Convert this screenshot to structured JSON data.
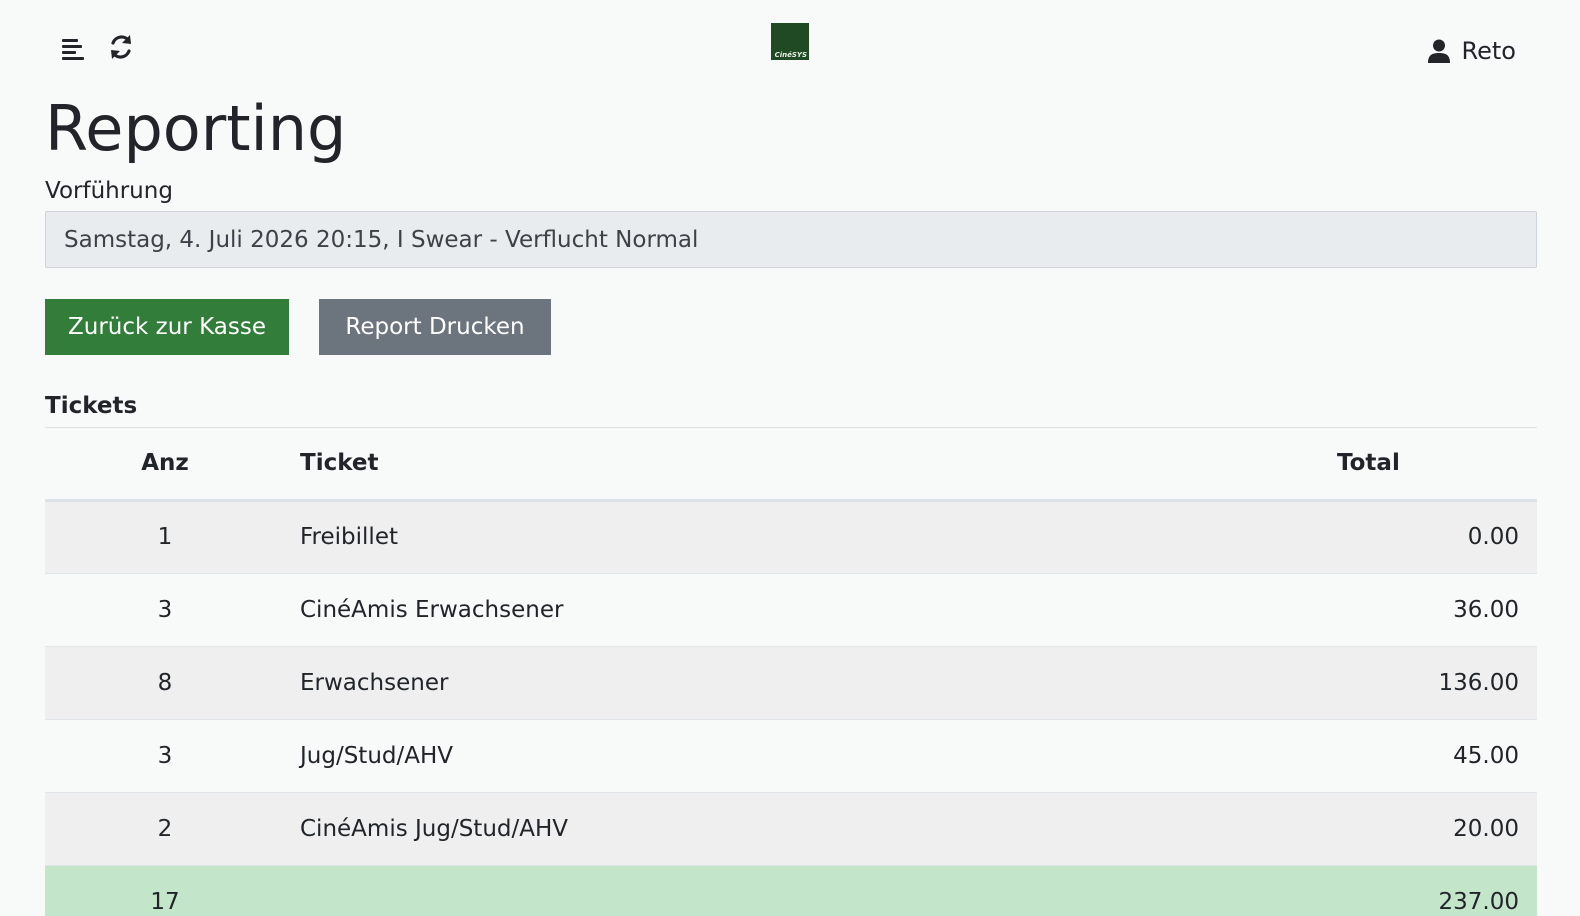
{
  "header": {
    "logo_text": "CinéSYS",
    "user_name": "Reto"
  },
  "page_title": "Reporting",
  "screening": {
    "label": "Vorführung",
    "selected": "Samstag, 4. Juli 2026 20:15, I Swear - Verflucht Normal"
  },
  "actions": {
    "back_label": "Zurück zur Kasse",
    "print_label": "Report Drucken"
  },
  "tickets": {
    "section_title": "Tickets",
    "columns": {
      "anz": "Anz",
      "ticket": "Ticket",
      "total": "Total"
    },
    "rows": [
      {
        "anz": "1",
        "ticket": "Freibillet",
        "total": "0.00"
      },
      {
        "anz": "3",
        "ticket": "CinéAmis Erwachsener",
        "total": "36.00"
      },
      {
        "anz": "8",
        "ticket": "Erwachsener",
        "total": "136.00"
      },
      {
        "anz": "3",
        "ticket": "Jug/Stud/AHV",
        "total": "45.00"
      },
      {
        "anz": "2",
        "ticket": "CinéAmis Jug/Stud/AHV",
        "total": "20.00"
      }
    ],
    "sum": {
      "anz": "17",
      "ticket": "",
      "total": "237.00"
    }
  },
  "colors": {
    "primary_green": "#327d3a",
    "secondary_gray": "#6c747e",
    "total_row_green": "#c3e6cb",
    "logo_green": "#1f4a23"
  }
}
